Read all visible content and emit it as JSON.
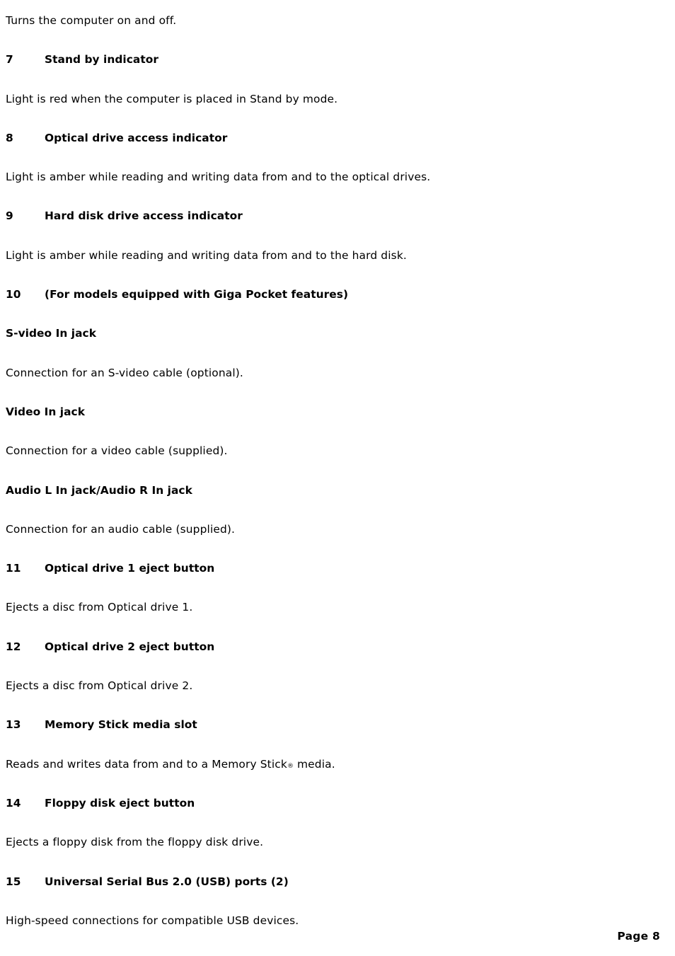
{
  "document": {
    "page_label": "Page 8",
    "blocks": [
      {
        "kind": "paragraph",
        "text": "Turns the computer on and off."
      },
      {
        "kind": "numbered-heading",
        "number": "7",
        "label": "Stand by indicator"
      },
      {
        "kind": "paragraph",
        "text": "Light is red when the computer is placed in Stand by mode."
      },
      {
        "kind": "numbered-heading",
        "number": "8",
        "label": "Optical drive access indicator"
      },
      {
        "kind": "paragraph",
        "text": "Light is amber while reading and writing data from and to the optical drives."
      },
      {
        "kind": "numbered-heading",
        "number": "9",
        "label": "Hard disk drive access indicator"
      },
      {
        "kind": "paragraph",
        "text": "Light is amber while reading and writing data from and to the hard disk."
      },
      {
        "kind": "numbered-heading",
        "number": "10",
        "label": "(For models equipped with Giga Pocket features)"
      },
      {
        "kind": "subheading",
        "text": "S-video In jack"
      },
      {
        "kind": "paragraph",
        "text": "Connection for an S-video cable (optional)."
      },
      {
        "kind": "subheading",
        "text": "Video In jack"
      },
      {
        "kind": "paragraph",
        "text": "Connection for a video cable (supplied)."
      },
      {
        "kind": "subheading",
        "text": "Audio L In jack/Audio R In jack"
      },
      {
        "kind": "paragraph",
        "text": "Connection for an audio cable (supplied)."
      },
      {
        "kind": "numbered-heading",
        "number": "11",
        "label": "Optical drive 1 eject button"
      },
      {
        "kind": "paragraph",
        "text": "Ejects a disc from Optical drive 1."
      },
      {
        "kind": "numbered-heading",
        "number": "12",
        "label": "Optical drive 2 eject button"
      },
      {
        "kind": "paragraph",
        "text": "Ejects a disc from Optical drive 2."
      },
      {
        "kind": "numbered-heading",
        "number": "13",
        "label": "Memory Stick media slot"
      },
      {
        "kind": "paragraph-trademark",
        "text_before": "Reads and writes data from and to a Memory Stick",
        "trademark": "®",
        "text_after": " media."
      },
      {
        "kind": "numbered-heading",
        "number": "14",
        "label": "Floppy disk eject button"
      },
      {
        "kind": "paragraph",
        "text": "Ejects a floppy disk from the floppy disk drive."
      },
      {
        "kind": "numbered-heading",
        "number": "15",
        "label": "Universal Serial Bus 2.0 (USB) ports (2)"
      },
      {
        "kind": "paragraph",
        "text": "High-speed connections for compatible USB devices."
      }
    ]
  }
}
